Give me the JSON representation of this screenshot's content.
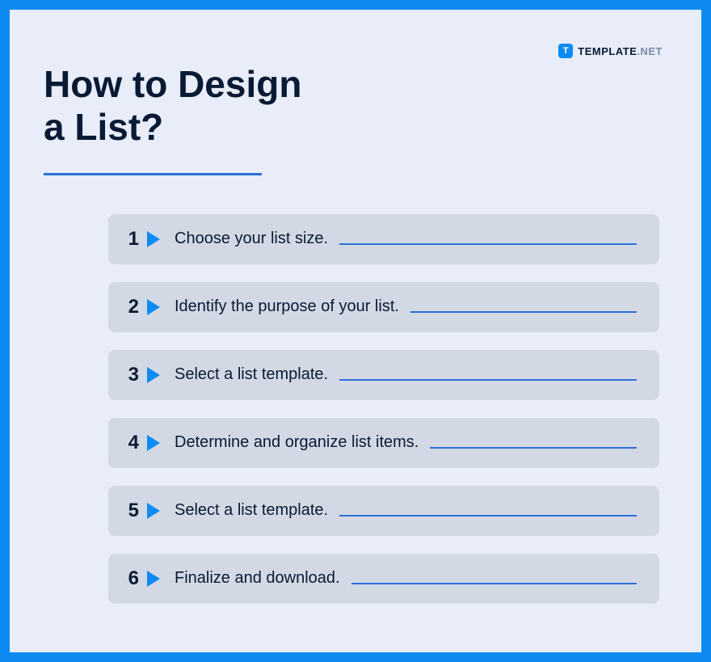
{
  "brand": {
    "badge": "T",
    "name": "TEMPLATE",
    "suffix": ".NET"
  },
  "title_line1": "How to Design",
  "title_line2": "a List?",
  "steps": [
    {
      "num": "1",
      "text": "Choose your list size."
    },
    {
      "num": "2",
      "text": "Identify the purpose of your list."
    },
    {
      "num": "3",
      "text": "Select a list template."
    },
    {
      "num": "4",
      "text": "Determine and organize list items."
    },
    {
      "num": "5",
      "text": "Select a list template."
    },
    {
      "num": "6",
      "text": "Finalize and download."
    }
  ]
}
